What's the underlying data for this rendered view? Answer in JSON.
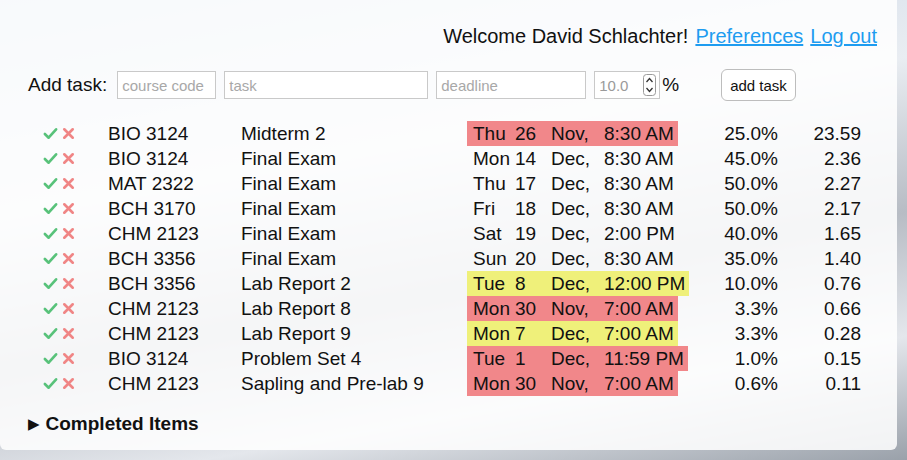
{
  "header": {
    "greeting": "Welcome David Schlachter!",
    "links": [
      "Preferences",
      "Log out"
    ]
  },
  "add_task": {
    "label": "Add task:",
    "fields": [
      {
        "placeholder": "course code"
      },
      {
        "placeholder": "task"
      },
      {
        "placeholder": "deadline"
      }
    ],
    "weight": {
      "placeholder": "10.0",
      "unit": "%"
    },
    "button": "add task"
  },
  "tasks": [
    {
      "course": "BIO 3124",
      "task": "Midterm 2",
      "deadline": {
        "day": "Thu",
        "date": "26",
        "month": "Nov,",
        "time": "8:30 AM"
      },
      "color": "#f1878a",
      "weight": "25.0%",
      "score": "23.59"
    },
    {
      "course": "BIO 3124",
      "task": "Final Exam",
      "deadline": {
        "day": "Mon",
        "date": "14",
        "month": "Dec,",
        "time": "8:30 AM"
      },
      "color": null,
      "weight": "45.0%",
      "score": "2.36"
    },
    {
      "course": "MAT 2322",
      "task": "Final Exam",
      "deadline": {
        "day": "Thu",
        "date": "17",
        "month": "Dec,",
        "time": "8:30 AM"
      },
      "color": null,
      "weight": "50.0%",
      "score": "2.27"
    },
    {
      "course": "BCH 3170",
      "task": "Final Exam",
      "deadline": {
        "day": "Fri",
        "date": "18",
        "month": "Dec,",
        "time": "8:30 AM"
      },
      "color": null,
      "weight": "50.0%",
      "score": "2.17"
    },
    {
      "course": "CHM 2123",
      "task": "Final Exam",
      "deadline": {
        "day": "Sat",
        "date": "19",
        "month": "Dec,",
        "time": "2:00 PM"
      },
      "color": null,
      "weight": "40.0%",
      "score": "1.65"
    },
    {
      "course": "BCH 3356",
      "task": "Final Exam",
      "deadline": {
        "day": "Sun",
        "date": "20",
        "month": "Dec,",
        "time": "8:30 AM"
      },
      "color": null,
      "weight": "35.0%",
      "score": "1.40"
    },
    {
      "course": "BCH 3356",
      "task": "Lab Report 2",
      "deadline": {
        "day": "Tue",
        "date": "8",
        "month": "Dec,",
        "time": "12:00 PM"
      },
      "color": "#eff07a",
      "weight": "10.0%",
      "score": "0.76"
    },
    {
      "course": "CHM 2123",
      "task": "Lab Report 8",
      "deadline": {
        "day": "Mon",
        "date": "30",
        "month": "Nov,",
        "time": "7:00 AM"
      },
      "color": "#f1878a",
      "weight": "3.3%",
      "score": "0.66"
    },
    {
      "course": "CHM 2123",
      "task": "Lab Report 9",
      "deadline": {
        "day": "Mon",
        "date": "7",
        "month": "Dec,",
        "time": "7:00 AM"
      },
      "color": "#eff07a",
      "weight": "3.3%",
      "score": "0.28"
    },
    {
      "course": "BIO 3124",
      "task": "Problem Set 4",
      "deadline": {
        "day": "Tue",
        "date": "1",
        "month": "Dec,",
        "time": "11:59 PM"
      },
      "color": "#f1878a",
      "weight": "1.0%",
      "score": "0.15"
    },
    {
      "course": "CHM 2123",
      "task": "Sapling and Pre-lab 9",
      "deadline": {
        "day": "Mon",
        "date": "30",
        "month": "Nov,",
        "time": "7:00 AM"
      },
      "color": "#f1878a",
      "weight": "0.6%",
      "score": "0.11"
    }
  ],
  "completed": {
    "toggle": "▶",
    "label": "Completed Items",
    "expanded": false
  }
}
